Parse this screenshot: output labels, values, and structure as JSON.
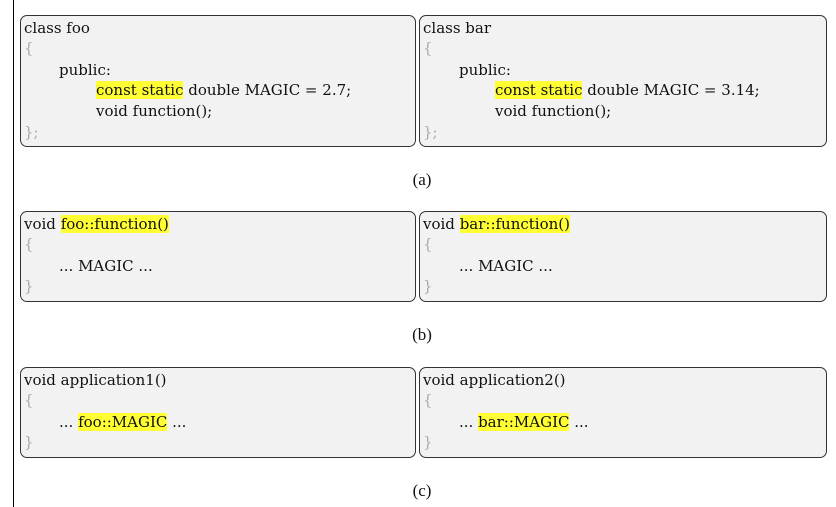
{
  "panel_a": {
    "caption": "(a)",
    "foo": {
      "class_line": "class foo",
      "open_brace": "{",
      "access": "public:",
      "decl_highlight": "const static",
      "decl_rest": " double MAGIC = 2.7;",
      "method": "void function();",
      "close": "};"
    },
    "bar": {
      "class_line": "class bar",
      "open_brace": "{",
      "access": "public:",
      "decl_highlight": "const static",
      "decl_rest": " double MAGIC = 3.14;",
      "method": "void function();",
      "close": "};"
    }
  },
  "panel_b": {
    "caption": "(b)",
    "foo": {
      "prefix": "void ",
      "signature_highlight": "foo::function()",
      "open_brace": "{",
      "body": "... MAGIC ...",
      "close": "}"
    },
    "bar": {
      "prefix": "void ",
      "signature_highlight": "bar::function()",
      "open_brace": "{",
      "body": "... MAGIC ...",
      "close": "}"
    }
  },
  "panel_c": {
    "caption": "(c)",
    "app1": {
      "signature": "void application1()",
      "open_brace": "{",
      "body_pre": "... ",
      "body_highlight": "foo::MAGIC",
      "body_post": " ...",
      "close": "}"
    },
    "app2": {
      "signature": "void application2()",
      "open_brace": "{",
      "body_pre": "... ",
      "body_highlight": "bar::MAGIC",
      "body_post": " ...",
      "close": "}"
    }
  }
}
